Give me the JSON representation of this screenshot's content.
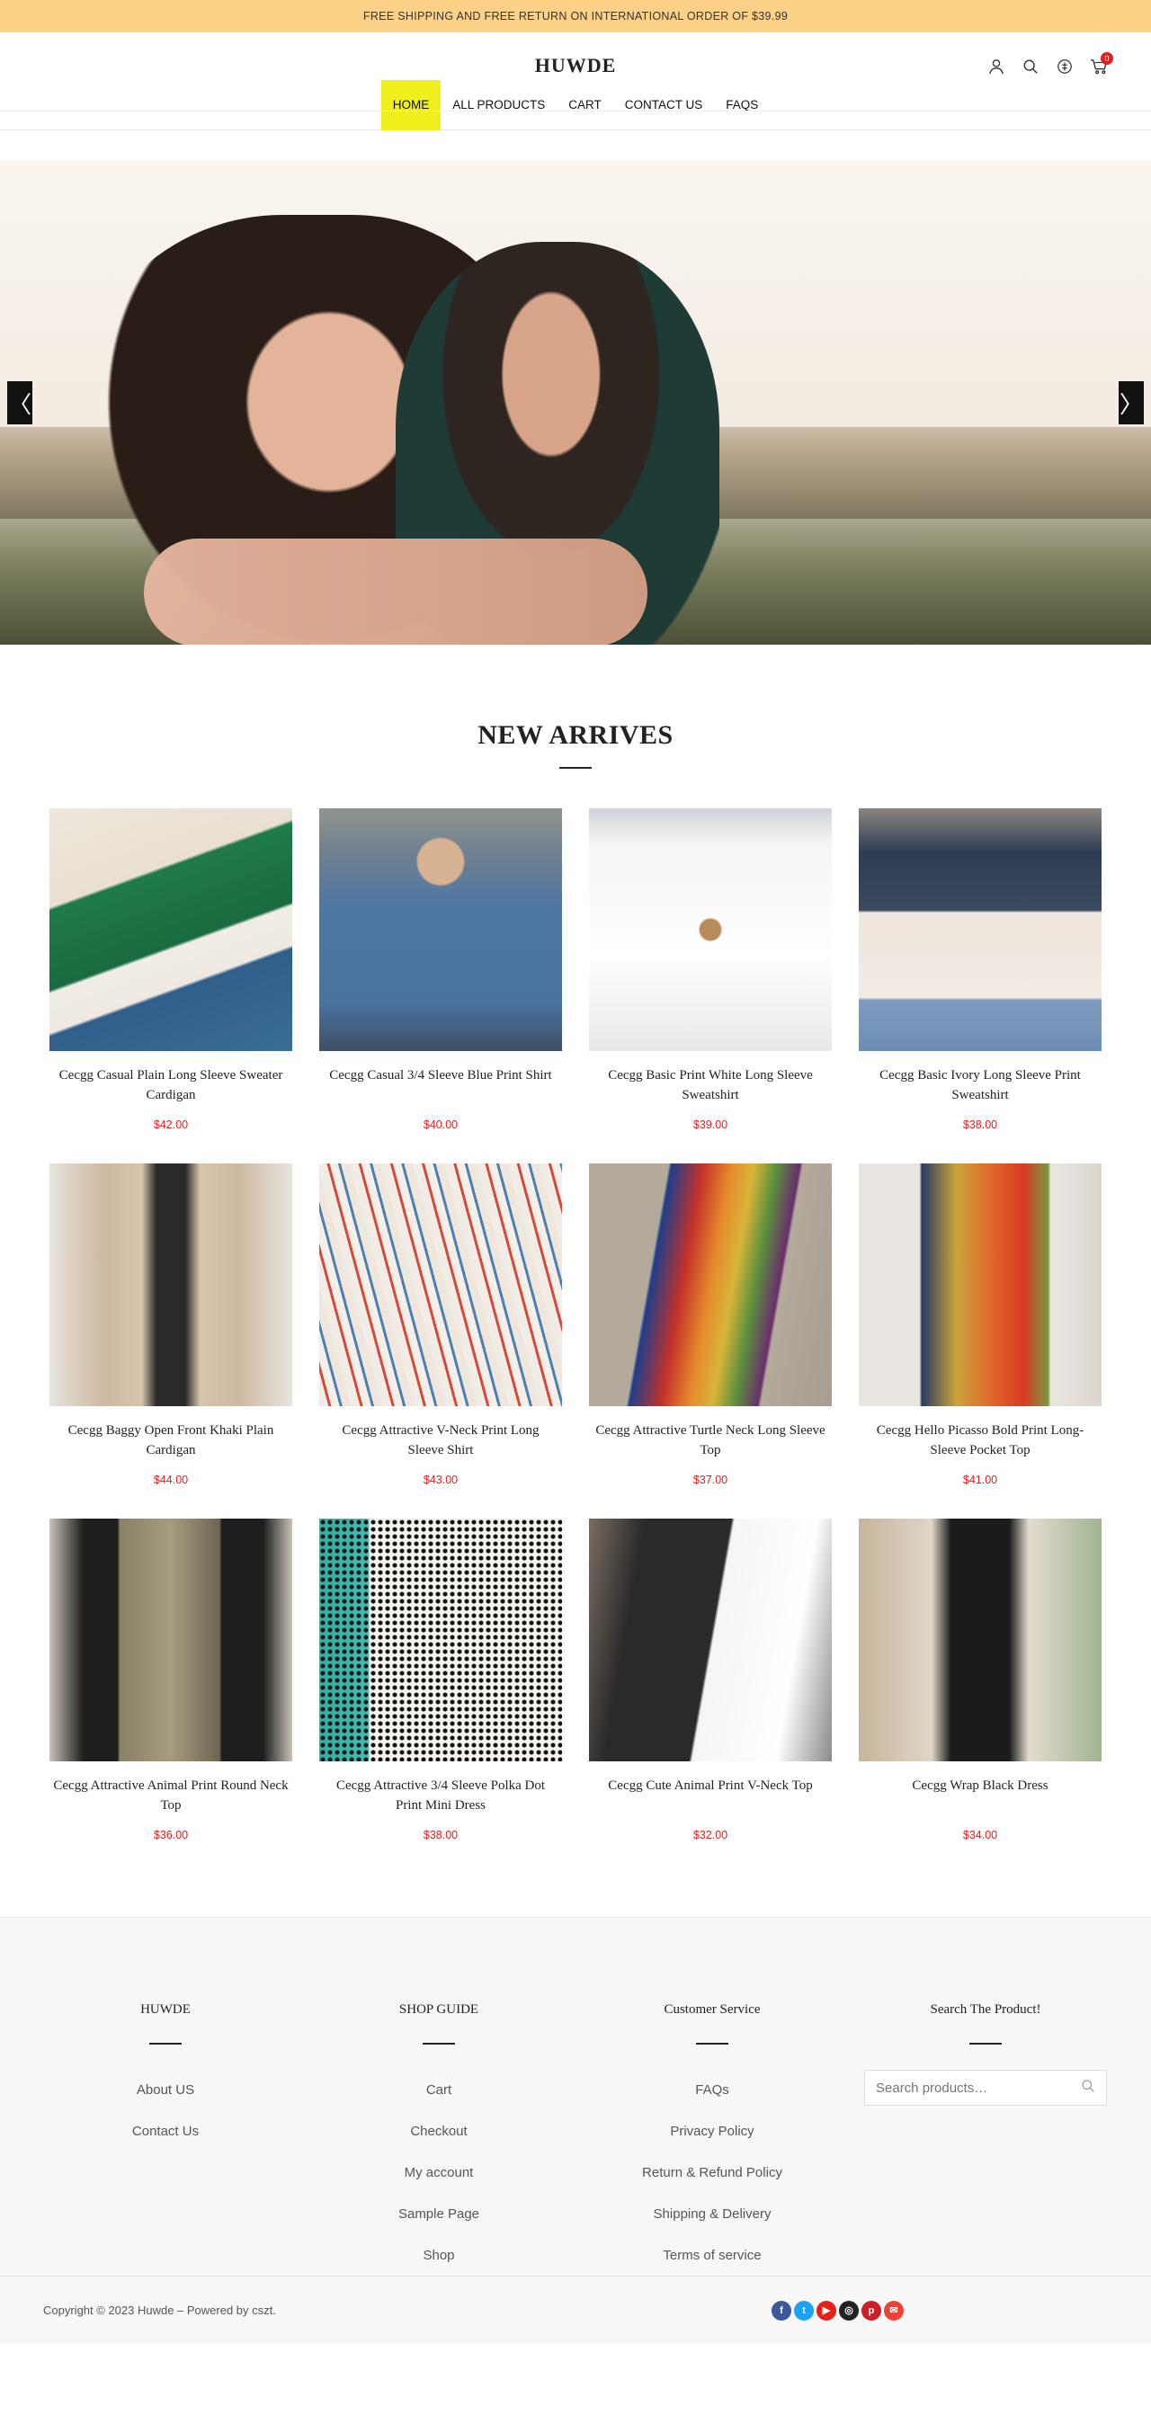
{
  "topbar": {
    "text": "FREE SHIPPING AND FREE RETURN ON INTERNATIONAL ORDER OF $39.99"
  },
  "header": {
    "logo": "HUWDE",
    "cart_count": "0",
    "icons": [
      "user-icon",
      "search-icon",
      "currency-icon",
      "cart-icon"
    ]
  },
  "nav": {
    "items": [
      "HOME",
      "ALL PRODUCTS",
      "CART",
      "CONTACT US",
      "FAQS"
    ],
    "active": "HOME"
  },
  "hero": {
    "prev": "〈",
    "next": "〉"
  },
  "products_section": {
    "title": "NEW ARRIVES",
    "products": [
      {
        "name": "Cecgg Casual Plain Long Sleeve Sweater Cardigan",
        "price": "$42.00"
      },
      {
        "name": "Cecgg Casual 3/4 Sleeve Blue Print Shirt",
        "price": "$40.00"
      },
      {
        "name": "Cecgg Basic Print White Long Sleeve Sweatshirt",
        "price": "$39.00"
      },
      {
        "name": "Cecgg Basic Ivory Long Sleeve Print Sweatshirt",
        "price": "$38.00"
      },
      {
        "name": "Cecgg Baggy Open Front Khaki Plain Cardigan",
        "price": "$44.00"
      },
      {
        "name": "Cecgg Attractive V-Neck Print Long Sleeve Shirt",
        "price": "$43.00"
      },
      {
        "name": "Cecgg Attractive Turtle Neck Long Sleeve Top",
        "price": "$37.00"
      },
      {
        "name": "Cecgg Hello Picasso Bold Print Long-Sleeve Pocket Top",
        "price": "$41.00"
      },
      {
        "name": "Cecgg Attractive Animal Print Round Neck Top",
        "price": "$36.00"
      },
      {
        "name": "Cecgg Attractive 3/4 Sleeve Polka Dot Print Mini Dress",
        "price": "$38.00"
      },
      {
        "name": "Cecgg Cute Animal Print V-Neck Top",
        "price": "$32.00"
      },
      {
        "name": "Cecgg Wrap Black Dress",
        "price": "$34.00"
      }
    ]
  },
  "footer": {
    "col1": {
      "title": "HUWDE",
      "links": [
        "About US",
        "Contact Us"
      ]
    },
    "col2": {
      "title": "SHOP GUIDE",
      "links": [
        "Cart",
        "Checkout",
        "My account",
        "Sample Page",
        "Shop"
      ]
    },
    "col3": {
      "title": "Customer Service",
      "links": [
        "FAQs",
        "Privacy Policy",
        "Return & Refund Policy",
        "Shipping & Delivery",
        "Terms of service"
      ]
    },
    "col4": {
      "title": "Search The Product!",
      "search_placeholder": "Search products…"
    },
    "copyright": "Copyright © 2023 Huwde – Powered by cszt.",
    "socials": [
      {
        "icon": "facebook-icon",
        "glyph": "f",
        "color": "#3b5998"
      },
      {
        "icon": "twitter-icon",
        "glyph": "t",
        "color": "#1da1f2"
      },
      {
        "icon": "youtube-icon",
        "glyph": "▶",
        "color": "#e62117"
      },
      {
        "icon": "instagram-icon",
        "glyph": "◎",
        "color": "#222222"
      },
      {
        "icon": "pinterest-icon",
        "glyph": "p",
        "color": "#cb2027"
      },
      {
        "icon": "email-icon",
        "glyph": "✉",
        "color": "#ea4335"
      }
    ]
  },
  "colors": {
    "topbar": "#fdd188",
    "nav_active": "#f0ef1e",
    "price": "#e02020"
  }
}
